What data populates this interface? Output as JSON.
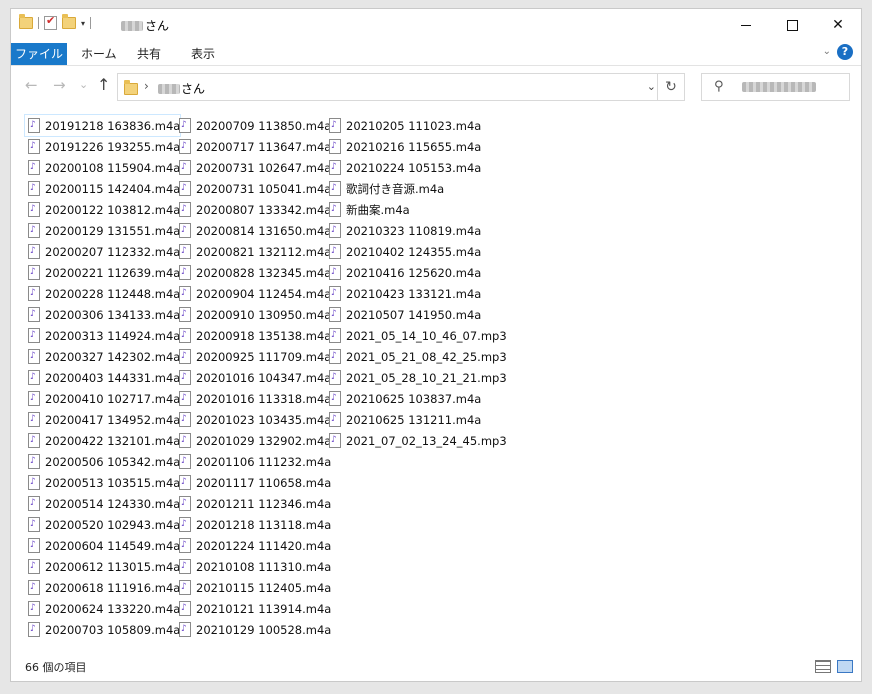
{
  "titlebar": {
    "title_suffix": "さん",
    "dropdown_glyph": "▾"
  },
  "ribbon": {
    "tabs": [
      "ファイル",
      "ホーム",
      "共有",
      "表示"
    ],
    "help": "?",
    "collapse": "⌄"
  },
  "navbar": {
    "back": "←",
    "forward": "→",
    "recent": "⌄",
    "up": "↑",
    "chevron": "›",
    "path_suffix": "さん",
    "dropdown": "⌄",
    "refresh": "↻",
    "search_icon": "⚲"
  },
  "files": {
    "columns": [
      [
        "20191218 163836.m4a",
        "20191226 193255.m4a",
        "20200108 115904.m4a",
        "20200115 142404.m4a",
        "20200122 103812.m4a",
        "20200129 131551.m4a",
        "20200207 112332.m4a",
        "20200221 112639.m4a",
        "20200228 112448.m4a",
        "20200306 134133.m4a",
        "20200313 114924.m4a",
        "20200327 142302.m4a",
        "20200403 144331.m4a",
        "20200410 102717.m4a",
        "20200417 134952.m4a",
        "20200422 132101.m4a",
        "20200506 105342.m4a",
        "20200513 103515.m4a",
        "20200514 124330.m4a",
        "20200520 102943.m4a",
        "20200604 114549.m4a",
        "20200612 113015.m4a",
        "20200618 111916.m4a",
        "20200624 133220.m4a",
        "20200703 105809.m4a"
      ],
      [
        "20200709 113850.m4a",
        "20200717 113647.m4a",
        "20200731 102647.m4a",
        "20200731 105041.m4a",
        "20200807 133342.m4a",
        "20200814 131650.m4a",
        "20200821 132112.m4a",
        "20200828 132345.m4a",
        "20200904 112454.m4a",
        "20200910 130950.m4a",
        "20200918 135138.m4a",
        "20200925 111709.m4a",
        "20201016 104347.m4a",
        "20201016 113318.m4a",
        "20201023 103435.m4a",
        "20201029 132902.m4a",
        "20201106 111232.m4a",
        "20201117 110658.m4a",
        "20201211 112346.m4a",
        "20201218 113118.m4a",
        "20201224 111420.m4a",
        "20210108 111310.m4a",
        "20210115 112405.m4a",
        "20210121 113914.m4a",
        "20210129 100528.m4a"
      ],
      [
        "20210205 111023.m4a",
        "20210216 115655.m4a",
        "20210224 105153.m4a",
        "歌詞付き音源.m4a",
        "新曲案.m4a",
        "20210323 110819.m4a",
        "20210402 124355.m4a",
        "20210416 125620.m4a",
        "20210423 133121.m4a",
        "20210507 141950.m4a",
        "2021_05_14_10_46_07.mp3",
        "2021_05_21_08_42_25.mp3",
        "2021_05_28_10_21_21.mp3",
        "20210625 103837.m4a",
        "20210625 131211.m4a",
        "2021_07_02_13_24_45.mp3"
      ]
    ]
  },
  "status": {
    "item_count": "66 個の項目"
  },
  "colors": {
    "file_tab": "#1979ca",
    "help_badge": "#1a6fc4"
  }
}
